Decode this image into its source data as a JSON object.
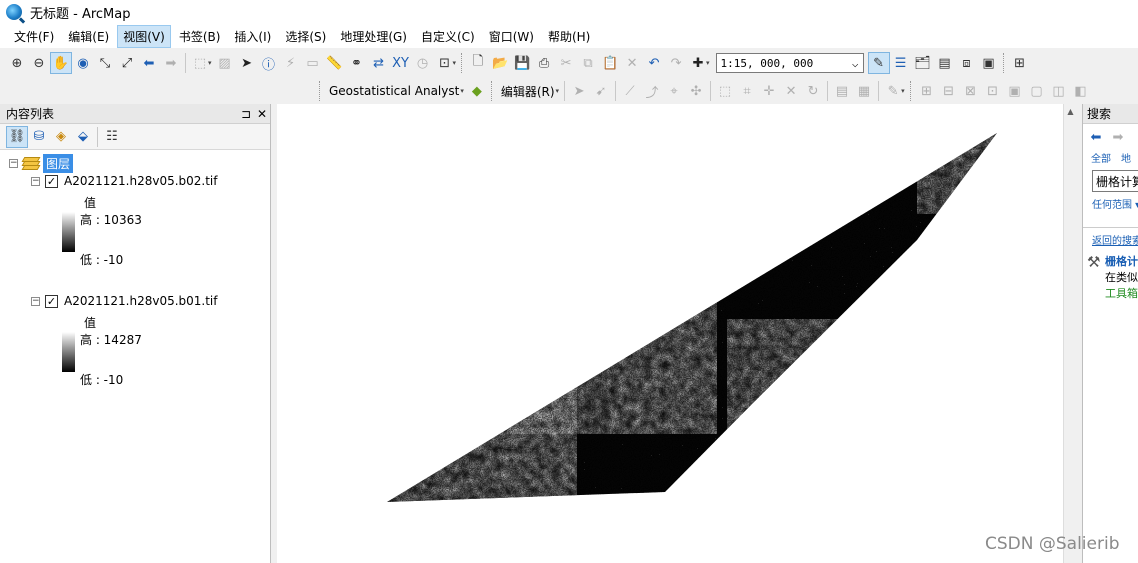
{
  "window": {
    "title": "无标题 - ArcMap"
  },
  "menu": {
    "items": [
      {
        "label": "文件(F)",
        "active": false
      },
      {
        "label": "编辑(E)",
        "active": false
      },
      {
        "label": "视图(V)",
        "active": true
      },
      {
        "label": "书签(B)",
        "active": false
      },
      {
        "label": "插入(I)",
        "active": false
      },
      {
        "label": "选择(S)",
        "active": false
      },
      {
        "label": "地理处理(G)",
        "active": false
      },
      {
        "label": "自定义(C)",
        "active": false
      },
      {
        "label": "窗口(W)",
        "active": false
      },
      {
        "label": "帮助(H)",
        "active": false
      }
    ]
  },
  "toolbar": {
    "scale_value": "1:15, 000, 000",
    "scale_arrow": "⌵",
    "geostat_label": "Geostatistical Analyst",
    "editor_label": "编辑器(R)",
    "dropdown_arrow": "▾"
  },
  "toc": {
    "title": "内容列表",
    "pin": "⊐",
    "close": "✕",
    "group_label": "图层",
    "layers": [
      {
        "name": "A2021121.h28v05.b02.tif",
        "value_label": "值",
        "high": "高 : 10363",
        "low": "低 : -10",
        "checked": "✓",
        "expander": "−"
      },
      {
        "name": "A2021121.h28v05.b01.tif",
        "value_label": "值",
        "high": "高 : 14287",
        "low": "低 : -10",
        "checked": "✓",
        "expander": "−"
      }
    ],
    "group_expander": "−"
  },
  "search": {
    "title": "搜索",
    "link_all": "全部",
    "link_second": "地",
    "input_value": "栅格计算器",
    "scope": "任何范围 ▾",
    "back_link": "返回的搜索",
    "result_title": "栅格计",
    "result_line2": "在类似",
    "result_line3": "工具箱"
  },
  "watermark": "CSDN @Salierib",
  "colors": {
    "accent": "#3a8ee6",
    "menu_highlight": "#cce4f7",
    "link": "#1a5fb4"
  }
}
